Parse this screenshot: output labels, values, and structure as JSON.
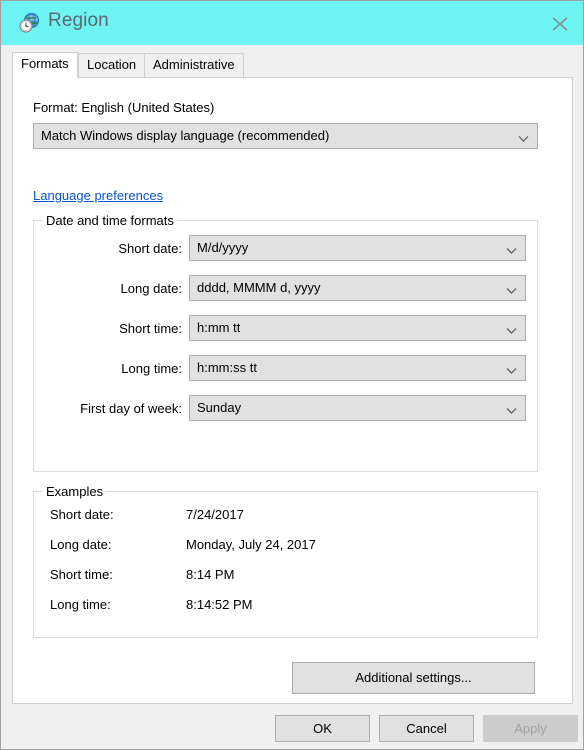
{
  "window": {
    "title": "Region",
    "icon": "region-globe-clock-icon",
    "titlebar_color": "#6ff4f4",
    "close_label": "close-icon"
  },
  "tabs": [
    {
      "label": "Formats",
      "active": true
    },
    {
      "label": "Location",
      "active": false
    },
    {
      "label": "Administrative",
      "active": false
    }
  ],
  "formats": {
    "format_label": "Format: English (United States)",
    "format_combo_value": "Match Windows display language (recommended)",
    "language_preferences_link": "Language preferences",
    "datetime_group_title": "Date and time formats",
    "fields": [
      {
        "label": "Short date:",
        "value": "M/d/yyyy"
      },
      {
        "label": "Long date:",
        "value": "dddd, MMMM d, yyyy"
      },
      {
        "label": "Short time:",
        "value": "h:mm tt"
      },
      {
        "label": "Long time:",
        "value": "h:mm:ss tt"
      },
      {
        "label": "First day of week:",
        "value": "Sunday"
      }
    ],
    "examples_group_title": "Examples",
    "examples": [
      {
        "label": "Short date:",
        "value": "7/24/2017"
      },
      {
        "label": "Long date:",
        "value": "Monday, July 24, 2017"
      },
      {
        "label": "Short time:",
        "value": "8:14 PM"
      },
      {
        "label": "Long time:",
        "value": "8:14:52 PM"
      }
    ],
    "additional_settings_label": "Additional settings..."
  },
  "footer": {
    "ok_label": "OK",
    "cancel_label": "Cancel",
    "apply_label": "Apply",
    "apply_enabled": false
  },
  "colors": {
    "titlebar": "#6ff4f4",
    "link": "#0a54c4",
    "control_face": "#e1e1e1",
    "disabled_text": "#a0a0a0"
  }
}
